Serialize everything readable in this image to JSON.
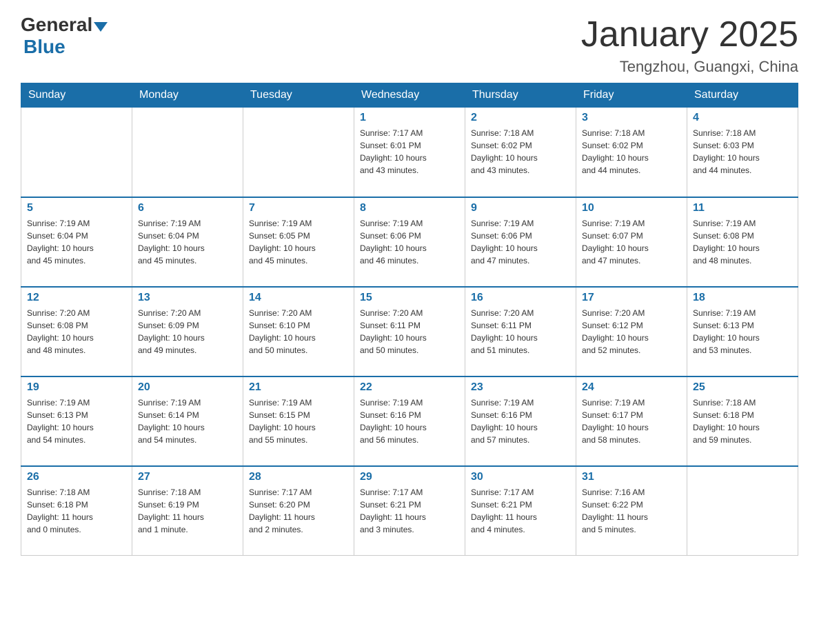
{
  "header": {
    "logo_general": "General",
    "logo_blue": "Blue",
    "month_title": "January 2025",
    "location": "Tengzhou, Guangxi, China"
  },
  "days_of_week": [
    "Sunday",
    "Monday",
    "Tuesday",
    "Wednesday",
    "Thursday",
    "Friday",
    "Saturday"
  ],
  "weeks": [
    [
      {
        "day": "",
        "info": ""
      },
      {
        "day": "",
        "info": ""
      },
      {
        "day": "",
        "info": ""
      },
      {
        "day": "1",
        "info": "Sunrise: 7:17 AM\nSunset: 6:01 PM\nDaylight: 10 hours\nand 43 minutes."
      },
      {
        "day": "2",
        "info": "Sunrise: 7:18 AM\nSunset: 6:02 PM\nDaylight: 10 hours\nand 43 minutes."
      },
      {
        "day": "3",
        "info": "Sunrise: 7:18 AM\nSunset: 6:02 PM\nDaylight: 10 hours\nand 44 minutes."
      },
      {
        "day": "4",
        "info": "Sunrise: 7:18 AM\nSunset: 6:03 PM\nDaylight: 10 hours\nand 44 minutes."
      }
    ],
    [
      {
        "day": "5",
        "info": "Sunrise: 7:19 AM\nSunset: 6:04 PM\nDaylight: 10 hours\nand 45 minutes."
      },
      {
        "day": "6",
        "info": "Sunrise: 7:19 AM\nSunset: 6:04 PM\nDaylight: 10 hours\nand 45 minutes."
      },
      {
        "day": "7",
        "info": "Sunrise: 7:19 AM\nSunset: 6:05 PM\nDaylight: 10 hours\nand 45 minutes."
      },
      {
        "day": "8",
        "info": "Sunrise: 7:19 AM\nSunset: 6:06 PM\nDaylight: 10 hours\nand 46 minutes."
      },
      {
        "day": "9",
        "info": "Sunrise: 7:19 AM\nSunset: 6:06 PM\nDaylight: 10 hours\nand 47 minutes."
      },
      {
        "day": "10",
        "info": "Sunrise: 7:19 AM\nSunset: 6:07 PM\nDaylight: 10 hours\nand 47 minutes."
      },
      {
        "day": "11",
        "info": "Sunrise: 7:19 AM\nSunset: 6:08 PM\nDaylight: 10 hours\nand 48 minutes."
      }
    ],
    [
      {
        "day": "12",
        "info": "Sunrise: 7:20 AM\nSunset: 6:08 PM\nDaylight: 10 hours\nand 48 minutes."
      },
      {
        "day": "13",
        "info": "Sunrise: 7:20 AM\nSunset: 6:09 PM\nDaylight: 10 hours\nand 49 minutes."
      },
      {
        "day": "14",
        "info": "Sunrise: 7:20 AM\nSunset: 6:10 PM\nDaylight: 10 hours\nand 50 minutes."
      },
      {
        "day": "15",
        "info": "Sunrise: 7:20 AM\nSunset: 6:11 PM\nDaylight: 10 hours\nand 50 minutes."
      },
      {
        "day": "16",
        "info": "Sunrise: 7:20 AM\nSunset: 6:11 PM\nDaylight: 10 hours\nand 51 minutes."
      },
      {
        "day": "17",
        "info": "Sunrise: 7:20 AM\nSunset: 6:12 PM\nDaylight: 10 hours\nand 52 minutes."
      },
      {
        "day": "18",
        "info": "Sunrise: 7:19 AM\nSunset: 6:13 PM\nDaylight: 10 hours\nand 53 minutes."
      }
    ],
    [
      {
        "day": "19",
        "info": "Sunrise: 7:19 AM\nSunset: 6:13 PM\nDaylight: 10 hours\nand 54 minutes."
      },
      {
        "day": "20",
        "info": "Sunrise: 7:19 AM\nSunset: 6:14 PM\nDaylight: 10 hours\nand 54 minutes."
      },
      {
        "day": "21",
        "info": "Sunrise: 7:19 AM\nSunset: 6:15 PM\nDaylight: 10 hours\nand 55 minutes."
      },
      {
        "day": "22",
        "info": "Sunrise: 7:19 AM\nSunset: 6:16 PM\nDaylight: 10 hours\nand 56 minutes."
      },
      {
        "day": "23",
        "info": "Sunrise: 7:19 AM\nSunset: 6:16 PM\nDaylight: 10 hours\nand 57 minutes."
      },
      {
        "day": "24",
        "info": "Sunrise: 7:19 AM\nSunset: 6:17 PM\nDaylight: 10 hours\nand 58 minutes."
      },
      {
        "day": "25",
        "info": "Sunrise: 7:18 AM\nSunset: 6:18 PM\nDaylight: 10 hours\nand 59 minutes."
      }
    ],
    [
      {
        "day": "26",
        "info": "Sunrise: 7:18 AM\nSunset: 6:18 PM\nDaylight: 11 hours\nand 0 minutes."
      },
      {
        "day": "27",
        "info": "Sunrise: 7:18 AM\nSunset: 6:19 PM\nDaylight: 11 hours\nand 1 minute."
      },
      {
        "day": "28",
        "info": "Sunrise: 7:17 AM\nSunset: 6:20 PM\nDaylight: 11 hours\nand 2 minutes."
      },
      {
        "day": "29",
        "info": "Sunrise: 7:17 AM\nSunset: 6:21 PM\nDaylight: 11 hours\nand 3 minutes."
      },
      {
        "day": "30",
        "info": "Sunrise: 7:17 AM\nSunset: 6:21 PM\nDaylight: 11 hours\nand 4 minutes."
      },
      {
        "day": "31",
        "info": "Sunrise: 7:16 AM\nSunset: 6:22 PM\nDaylight: 11 hours\nand 5 minutes."
      },
      {
        "day": "",
        "info": ""
      }
    ]
  ]
}
